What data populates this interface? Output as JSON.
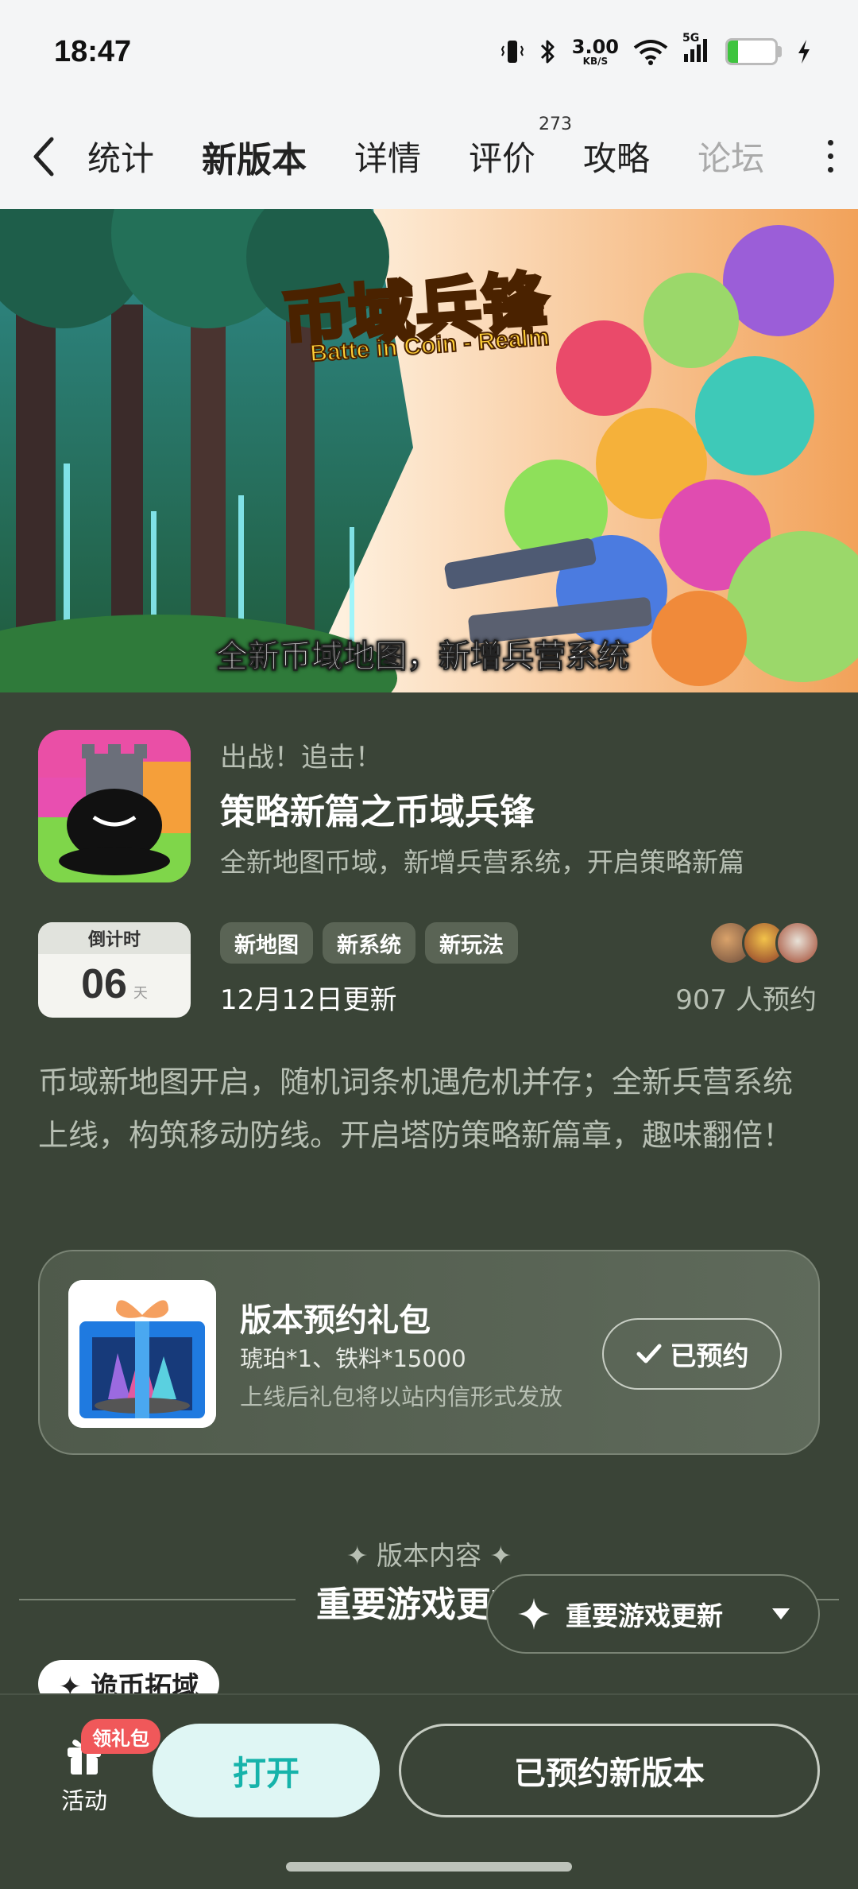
{
  "status_bar": {
    "time": "18:47",
    "net_speed_value": "3.00",
    "net_speed_unit": "KB/S",
    "signal_label": "5G",
    "battery_level": "21",
    "battery_fill_percent": 21,
    "icons": [
      "vibrate-icon",
      "bluetooth-icon",
      "wifi-icon",
      "signal-icon",
      "battery-icon",
      "charging-icon"
    ]
  },
  "header": {
    "tabs": [
      {
        "label": "统计",
        "active": false
      },
      {
        "label": "新版本",
        "active": true
      },
      {
        "label": "详情",
        "active": false
      },
      {
        "label": "评价",
        "active": false,
        "count": "273"
      },
      {
        "label": "攻略",
        "active": false
      },
      {
        "label": "论坛",
        "active": false
      }
    ]
  },
  "banner": {
    "title": "币域兵锋",
    "subtitle": "Batte in Coin - Realm",
    "caption": "全新币域地图，新增兵营系统"
  },
  "game_info": {
    "kicker": "出战！追击！",
    "title": "策略新篇之币域兵锋",
    "description": "全新地图币域，新增兵营系统，开启策略新篇",
    "countdown_label": "倒计时",
    "countdown_value": "06",
    "countdown_unit": "天",
    "tags": [
      "新地图",
      "新系统",
      "新玩法"
    ],
    "update_date": "12月12日更新",
    "reservation_count": "907 人预约"
  },
  "description_paragraph": "币域新地图开启，随机词条机遇危机并存；全新兵营系统上线，构筑移动防线。开启塔防策略新篇章，趣味翻倍！",
  "gift_pack": {
    "title": "版本预约礼包",
    "items": "琥珀*1、铁料*15000",
    "note": "上线后礼包将以站内信形式发放",
    "button_label": "已预约"
  },
  "version_content": {
    "label": "✦ 版本内容 ✦",
    "heading": "重要游戏更新",
    "dropdown_label": "重要游戏更新",
    "chip_label": "✦ 诡币拓域"
  },
  "bottom_bar": {
    "activity_label": "活动",
    "gift_badge": "领礼包",
    "open_button": "打开",
    "reserved_button": "已预约新版本"
  },
  "colors": {
    "accent": "#22c9c0",
    "background": "#3a4437",
    "open_button_bg": "#dff6f4",
    "open_button_text": "#16b3aa",
    "badge_red": "#f0585a"
  }
}
